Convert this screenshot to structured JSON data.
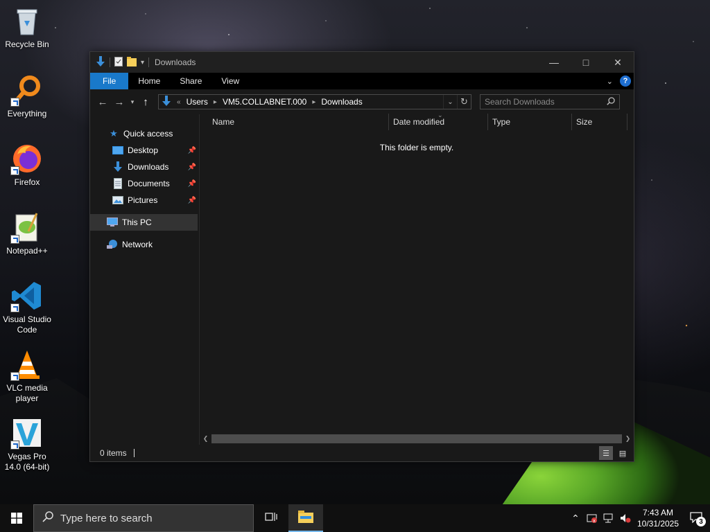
{
  "desktop": {
    "icons": [
      {
        "label": "Recycle Bin",
        "icon": "recycle-bin-icon"
      },
      {
        "label": "Everything",
        "icon": "everything-search-icon"
      },
      {
        "label": "Firefox",
        "icon": "firefox-icon"
      },
      {
        "label": "Notepad++",
        "icon": "notepad-plus-plus-icon"
      },
      {
        "label": "Visual Studio Code",
        "icon": "vscode-icon"
      },
      {
        "label": "VLC media player",
        "icon": "vlc-icon"
      },
      {
        "label": "Vegas Pro 14.0 (64-bit)",
        "icon": "vegas-pro-icon"
      }
    ]
  },
  "explorer": {
    "title": "Downloads",
    "ribbon": {
      "tabs": [
        "File",
        "Home",
        "Share",
        "View"
      ]
    },
    "address": {
      "crumbs": [
        "Users",
        "VM5.COLLABNET.000",
        "Downloads"
      ]
    },
    "search": {
      "placeholder": "Search Downloads"
    },
    "navpane": {
      "quick_access": "Quick access",
      "pinned": [
        {
          "label": "Desktop",
          "icon": "desktop-folder-icon"
        },
        {
          "label": "Downloads",
          "icon": "downloads-folder-icon"
        },
        {
          "label": "Documents",
          "icon": "documents-folder-icon"
        },
        {
          "label": "Pictures",
          "icon": "pictures-folder-icon"
        }
      ],
      "this_pc": "This PC",
      "network": "Network"
    },
    "columns": [
      "Name",
      "Date modified",
      "Type",
      "Size"
    ],
    "empty_message": "This folder is empty.",
    "status": {
      "items": "0 items"
    }
  },
  "taskbar": {
    "search_placeholder": "Type here to search",
    "clock": {
      "time": "7:43 AM",
      "date": "10/31/2025"
    },
    "notifications": "3"
  },
  "colors": {
    "accent": "#1979ca",
    "window_bg": "#191919",
    "taskbar_bg": "#101010"
  }
}
